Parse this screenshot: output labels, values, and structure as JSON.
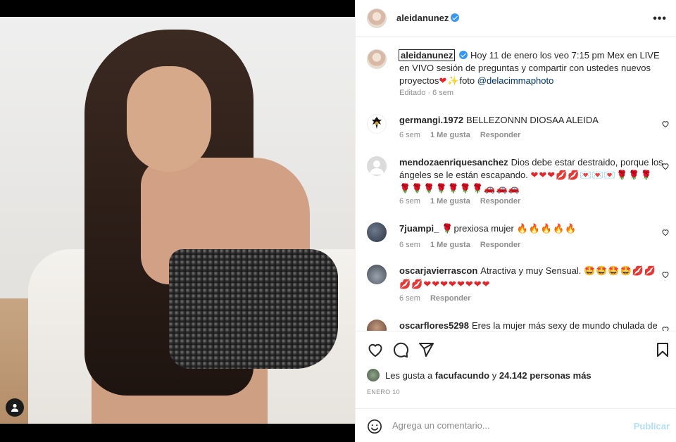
{
  "post": {
    "author": "aleidanunez",
    "verified": true,
    "caption_author": "aleidanunez",
    "caption_text": "Hoy 11 de enero los veo 7:15 pm Mex en LIVE en VIVO sesión de preguntas y compartir con ustedes nuevos proyectos",
    "caption_emoji": "❤✨",
    "caption_suffix": "foto ",
    "caption_mention": "@delacimmaphoto",
    "caption_meta": "Editado · 6 sem",
    "more_icon": "more-horizontal-icon"
  },
  "comments": [
    {
      "user": "germangi.1972",
      "text": "BELLEZONNN DIOSAA ALEIDA",
      "time": "6 sem",
      "likes": "1 Me gusta",
      "reply": "Responder"
    },
    {
      "user": "mendozaenriquesanchez",
      "text": "Dios debe estar destraido, porque los ángeles se le están escapando.",
      "emoji": "❤❤❤💋💋💌💌💌🌹🌹🌹🌹🌹🌹🌹🌹🌹🌹🚗🚗🚗",
      "time": "6 sem",
      "likes": "1 Me gusta",
      "reply": "Responder"
    },
    {
      "user": "7juampi_",
      "text": "prexiosa mujer",
      "emoji_prefix": "🌹",
      "emoji": "🔥🔥🔥🔥🔥",
      "time": "6 sem",
      "likes": "1 Me gusta",
      "reply": "Responder"
    },
    {
      "user": "oscarjavierrascon",
      "text": "Atractiva y muy Sensual.",
      "emoji": "🤩🤩🤩🤩💋💋💋💋❤❤❤❤❤❤❤❤",
      "time": "6 sem",
      "reply": "Responder"
    },
    {
      "user": "oscarflores5298",
      "text": "Eres la mujer más sexy de mundo chulada de"
    }
  ],
  "actions": {
    "like_icon": "heart-icon",
    "comment_icon": "comment-icon",
    "share_icon": "send-icon",
    "save_icon": "bookmark-icon"
  },
  "likes": {
    "prefix": "Les gusta a ",
    "user": "facufacundo",
    "middle": " y ",
    "count": "24.142 personas más"
  },
  "date": "ENERO 10",
  "add_comment": {
    "placeholder": "Agrega un comentario...",
    "publish": "Publicar",
    "emoji_icon": "smiley-icon"
  },
  "colors": {
    "accent": "#3897f0",
    "publish_disabled": "#b2dffc",
    "text": "#262626",
    "muted": "#8e8e8e",
    "link": "#00376b"
  }
}
